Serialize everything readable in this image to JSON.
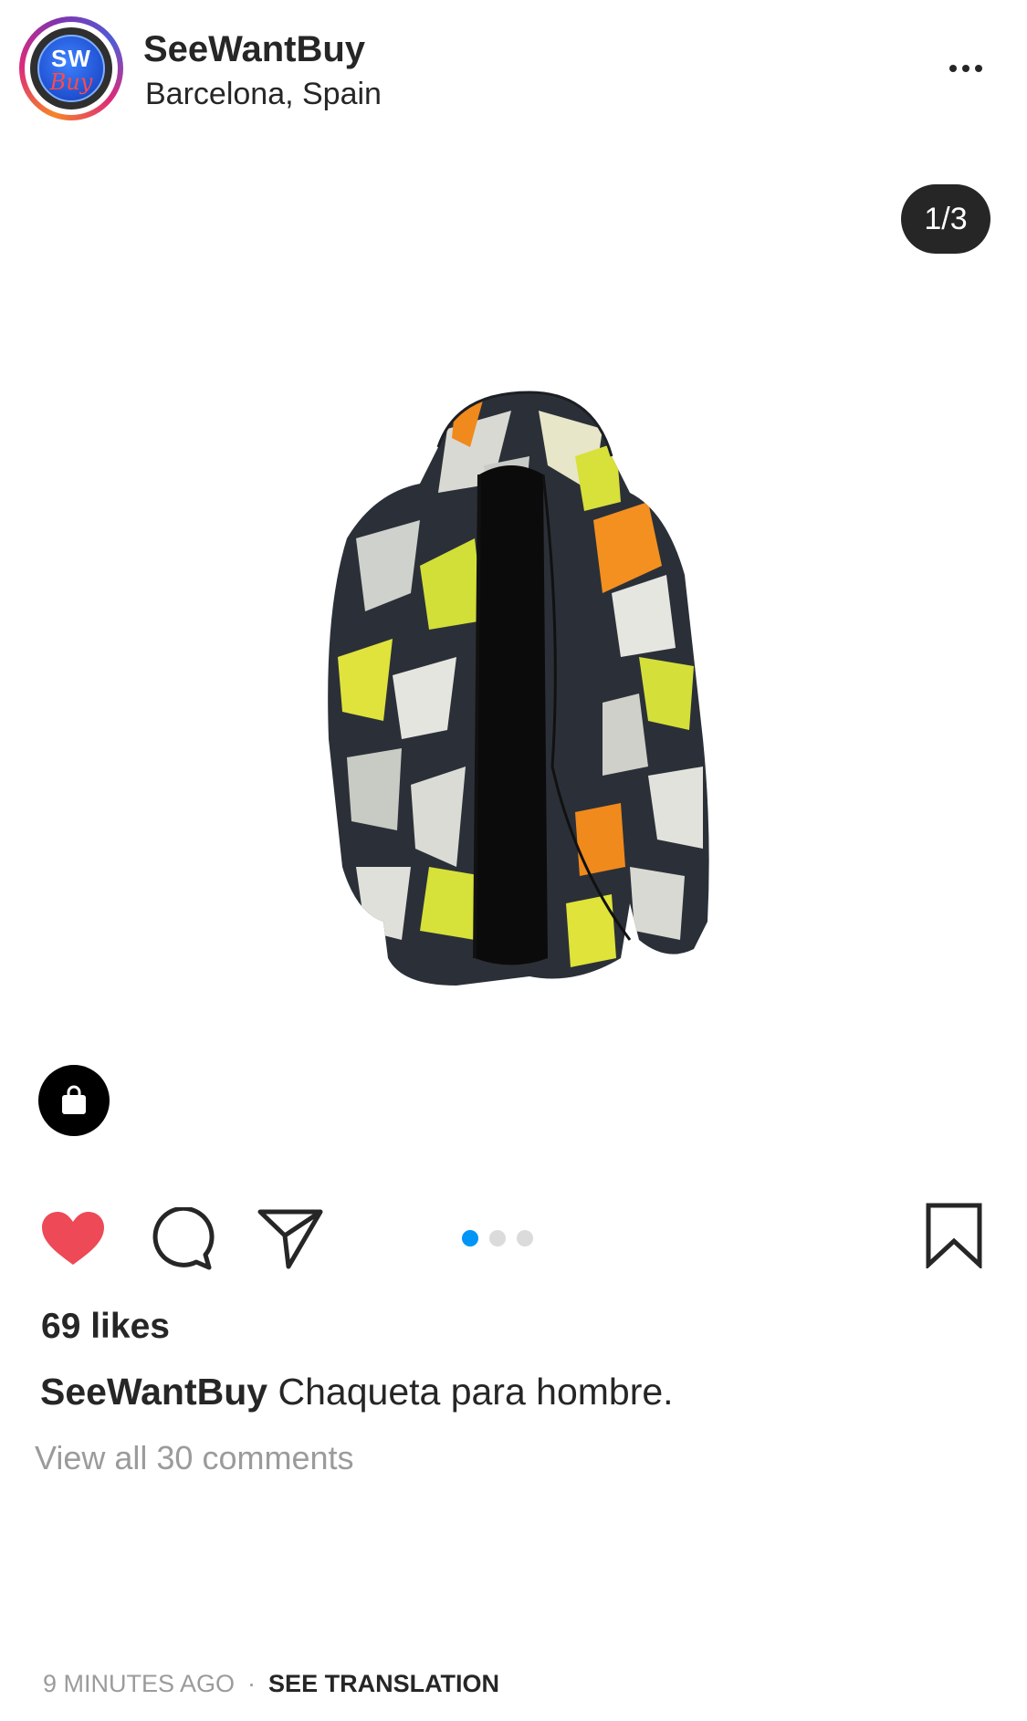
{
  "header": {
    "username": "SeeWantBuy",
    "location": "Barcelona, Spain",
    "avatar_text_top": "SW",
    "avatar_text_bottom": "Buy",
    "more_icon": "more-horizontal-icon"
  },
  "media": {
    "counter": "1/3",
    "image_subject": "camouflage hooded jacket",
    "shop_icon": "shopping-bag-icon"
  },
  "actions": {
    "like_icon": "heart-icon",
    "liked": true,
    "like_color": "#ed4956",
    "comment_icon": "comment-icon",
    "share_icon": "send-icon",
    "save_icon": "bookmark-icon",
    "pager": {
      "total": 3,
      "active": 1,
      "active_color": "#0095f6"
    }
  },
  "post": {
    "likes": "69 likes",
    "caption_user": "SeeWantBuy",
    "caption_text": "Chaqueta para hombre.",
    "view_comments": "View all 30 comments",
    "timestamp": "9 MINUTES AGO",
    "separator": "·",
    "see_translation": "SEE TRANSLATION"
  }
}
